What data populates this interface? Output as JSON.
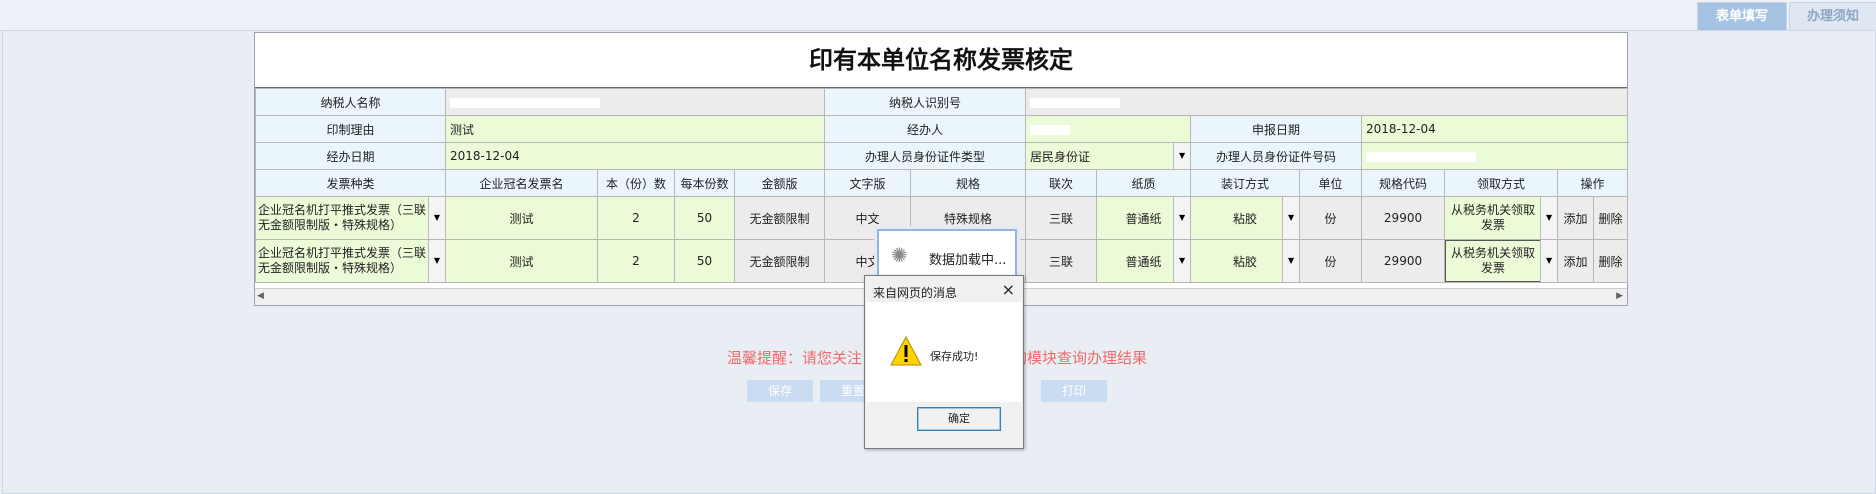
{
  "tabs": {
    "fill": "表单填写",
    "notice": "办理须知"
  },
  "form": {
    "title": "印有本单位名称发票核定",
    "labels": {
      "taxpayer_name": "纳税人名称",
      "taxpayer_id": "纳税人识别号",
      "print_reason": "印制理由",
      "handler": "经办人",
      "report_date": "申报日期",
      "handle_date": "经办日期",
      "id_type": "办理人员身份证件类型",
      "id_number": "办理人员身份证件号码"
    },
    "values": {
      "print_reason": "测试",
      "report_date": "2018-12-04",
      "handle_date": "2018-12-04",
      "id_type": "居民身份证"
    },
    "columns": [
      "发票种类",
      "企业冠名发票名",
      "本（份）数",
      "每本份数",
      "金额版",
      "文字版",
      "规格",
      "联次",
      "纸质",
      "装订方式",
      "单位",
      "规格代码",
      "领取方式",
      "操作"
    ],
    "rows": [
      {
        "kind": "企业冠名机打平推式发票（三联无金额限制版・特殊规格）",
        "name": "测试",
        "count": "2",
        "per": "50",
        "amount": "无金额限制",
        "text": "中文",
        "spec": "特殊规格",
        "copies": "三联",
        "paper": "普通纸",
        "binding": "粘胶",
        "unit": "份",
        "code": "29900",
        "pickup": "从税务机关领取发票",
        "add": "添加",
        "del": "删除"
      },
      {
        "kind": "企业冠名机打平推式发票（三联无金额限制版・特殊规格）",
        "name": "测试",
        "count": "2",
        "per": "50",
        "amount": "无金额限制",
        "text": "中文",
        "spec": "",
        "copies": "三联",
        "paper": "普通纸",
        "binding": "粘胶",
        "unit": "份",
        "code": "29900",
        "pickup": "从税务机关领取发票",
        "add": "添加",
        "del": "删除"
      }
    ]
  },
  "reminder": "温馨提醒：请您关注",
  "reminder_tail": "询模块查询办理结果",
  "buttons": {
    "save": "保存",
    "reset": "重置",
    "print": "打印"
  },
  "loading": {
    "text": "数据加载中..."
  },
  "dialog": {
    "title": "来自网页的消息",
    "message": "保存成功!",
    "ok": "确定",
    "close": "×"
  },
  "colors": {
    "label_bg": "#eaf6fb",
    "value_bg": "#ebfbd7",
    "tab_active": "#a6c3e4",
    "reminder": "#f16a6a"
  }
}
